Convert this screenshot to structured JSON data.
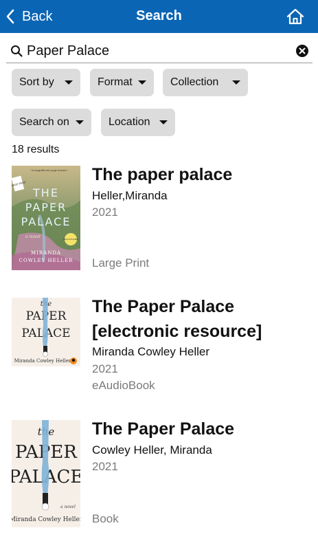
{
  "header": {
    "back_label": "Back",
    "title": "Search",
    "home_icon": "home-icon",
    "color": "#0a65b5"
  },
  "search": {
    "value": "Paper Palace",
    "search_icon": "magnifier-icon",
    "clear_icon": "clear-x-icon"
  },
  "filters": [
    {
      "label": "Sort by"
    },
    {
      "label": "Format"
    },
    {
      "label": "Collection"
    },
    {
      "label": "Search on"
    },
    {
      "label": "Location"
    }
  ],
  "results_count": "18 results",
  "results": [
    {
      "title": "The paper palace",
      "author": "Heller,Miranda",
      "year": "2021",
      "format": "Large Print",
      "cover": {
        "badge": "LARGE PRINT",
        "blurb": "\"A magnificent page-turner.\"",
        "title_lines": [
          "THE",
          "PAPER",
          "PALACE"
        ],
        "subtitle": "a novel",
        "author_lines": [
          "MIRANDA",
          "COWLEY HELLER"
        ],
        "sticker": "READ WITH JENNA"
      }
    },
    {
      "title": "The Paper Palace [electronic resource]",
      "author": "Miranda Cowley Heller",
      "year": "2021",
      "format": "eAudioBook",
      "cover": {
        "title_lines": [
          "the",
          "PAPER",
          "PALACE"
        ],
        "author_line": "Miranda Cowley Heller"
      }
    },
    {
      "title": "The Paper Palace",
      "author": "Cowley Heller, Miranda",
      "year": "2021",
      "format": "Book",
      "cover": {
        "title_lines": [
          "the",
          "PAPER",
          "PALACE"
        ],
        "subtitle": "a novel",
        "author_line": "Miranda Cowley Heller"
      }
    }
  ]
}
